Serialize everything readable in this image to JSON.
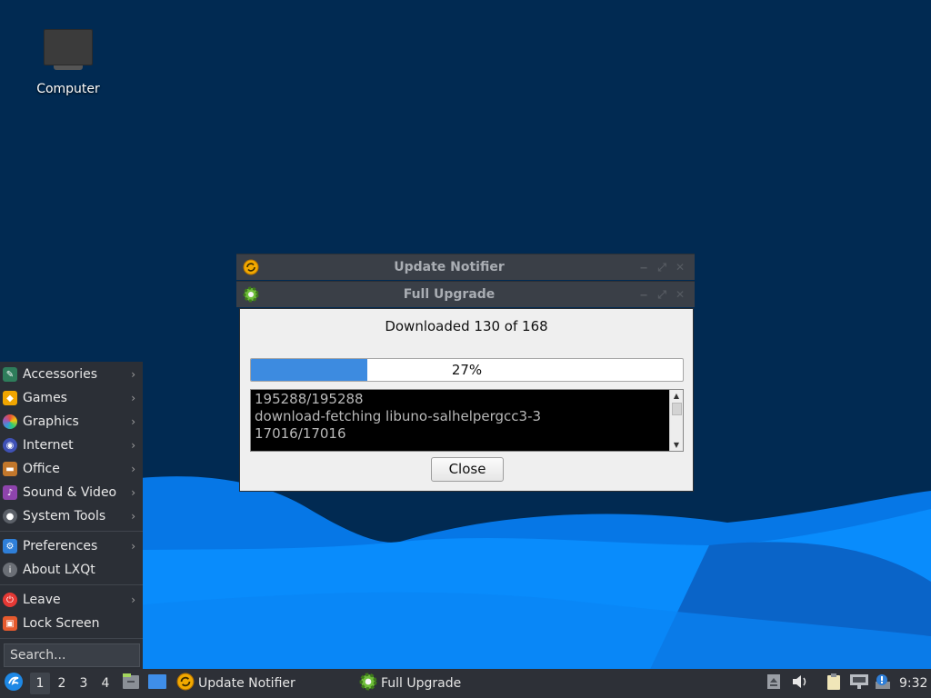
{
  "desktop": {
    "computer_label": "Computer"
  },
  "colors": {
    "accent": "#3d8be0",
    "desktop_bg": "#012a52",
    "panel_bg": "#2d3037",
    "wave_light": "#0a8fff",
    "wave_dark": "#0066cc"
  },
  "window1": {
    "title": "Update Notifier",
    "icon": "update-notifier-icon"
  },
  "window2": {
    "title": "Full Upgrade",
    "icon": "gear-icon"
  },
  "dialog": {
    "heading": "Downloaded 130 of 168",
    "progress_percent": 27,
    "progress_label": "27%",
    "log_lines": [
      "195288/195288",
      "download-fetching libuno-salhelpergcc3-3",
      "17016/17016"
    ],
    "close_label": "Close"
  },
  "menu": {
    "items": [
      {
        "label": "Accessories",
        "icon": "accessories-icon",
        "submenu": true
      },
      {
        "label": "Games",
        "icon": "games-icon",
        "submenu": true
      },
      {
        "label": "Graphics",
        "icon": "graphics-icon",
        "submenu": true
      },
      {
        "label": "Internet",
        "icon": "internet-icon",
        "submenu": true
      },
      {
        "label": "Office",
        "icon": "office-icon",
        "submenu": true
      },
      {
        "label": "Sound & Video",
        "icon": "sound-video-icon",
        "submenu": true
      },
      {
        "label": "System Tools",
        "icon": "system-tools-icon",
        "submenu": true
      }
    ],
    "items2": [
      {
        "label": "Preferences",
        "icon": "preferences-icon",
        "submenu": true
      },
      {
        "label": "About LXQt",
        "icon": "info-icon",
        "submenu": false
      }
    ],
    "items3": [
      {
        "label": "Leave",
        "icon": "power-icon",
        "submenu": true
      },
      {
        "label": "Lock Screen",
        "icon": "lock-icon",
        "submenu": false
      }
    ],
    "search_placeholder": "Search..."
  },
  "taskbar": {
    "workspaces": [
      "1",
      "2",
      "3",
      "4"
    ],
    "active_workspace": "1",
    "tasks": [
      {
        "label": "Update Notifier",
        "icon": "update-notifier-icon"
      },
      {
        "label": "Full Upgrade",
        "icon": "gear-icon"
      }
    ],
    "clock": "9:32"
  }
}
